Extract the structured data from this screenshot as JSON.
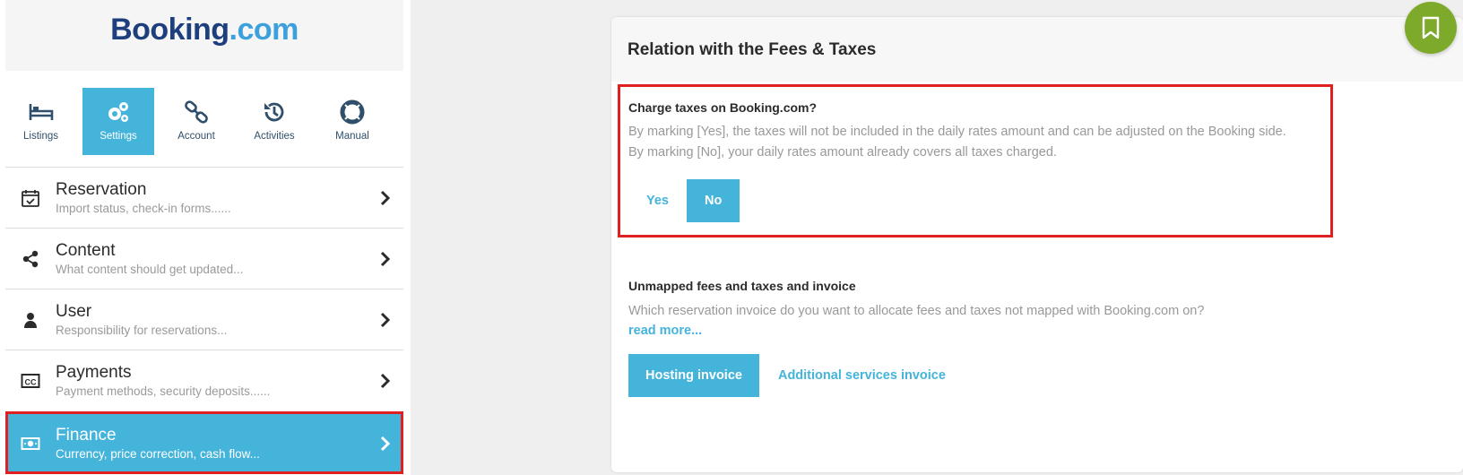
{
  "logo": {
    "part1": "Booking",
    "dot": ".",
    "part2": "com"
  },
  "tabs": [
    {
      "label": "Listings",
      "icon": "bed-icon"
    },
    {
      "label": "Settings",
      "icon": "gears-icon",
      "active": true
    },
    {
      "label": "Account",
      "icon": "link-icon"
    },
    {
      "label": "Activities",
      "icon": "history-icon"
    },
    {
      "label": "Manual",
      "icon": "lifebuoy-icon"
    }
  ],
  "menu": [
    {
      "title": "Reservation",
      "subtitle": "Import status, check-in forms......",
      "icon": "calendar-check-icon"
    },
    {
      "title": "Content",
      "subtitle": "What content should get updated...",
      "icon": "share-icon"
    },
    {
      "title": "User",
      "subtitle": "Responsibility for reservations...",
      "icon": "user-icon"
    },
    {
      "title": "Payments",
      "subtitle": "Payment methods, security deposits......",
      "icon": "cc-icon"
    },
    {
      "title": "Finance",
      "subtitle": "Currency, price correction, cash flow...",
      "icon": "money-icon",
      "active": true
    }
  ],
  "card": {
    "title": "Relation with the Fees & Taxes",
    "charge_taxes": {
      "question": "Charge taxes on Booking.com?",
      "desc_line1": "By marking [Yes], the taxes will not be included in the daily rates amount and can be adjusted on the Booking side.",
      "desc_line2": "By marking [No], your daily rates amount already covers all taxes charged.",
      "yes_label": "Yes",
      "no_label": "No",
      "selected": "No"
    },
    "unmapped": {
      "question": "Unmapped fees and taxes and invoice",
      "desc": "Which reservation invoice do you want to allocate fees and taxes not mapped with Booking.com on?",
      "read_more": "read more...",
      "hosting_label": "Hosting invoice",
      "additional_label": "Additional services invoice",
      "selected": "Hosting invoice"
    }
  },
  "colors": {
    "accent": "#45b4da",
    "highlight": "#e02020",
    "fab": "#7daa2b",
    "brand_dark": "#1e3f7d"
  },
  "fab": {
    "icon": "bookmark-icon"
  }
}
